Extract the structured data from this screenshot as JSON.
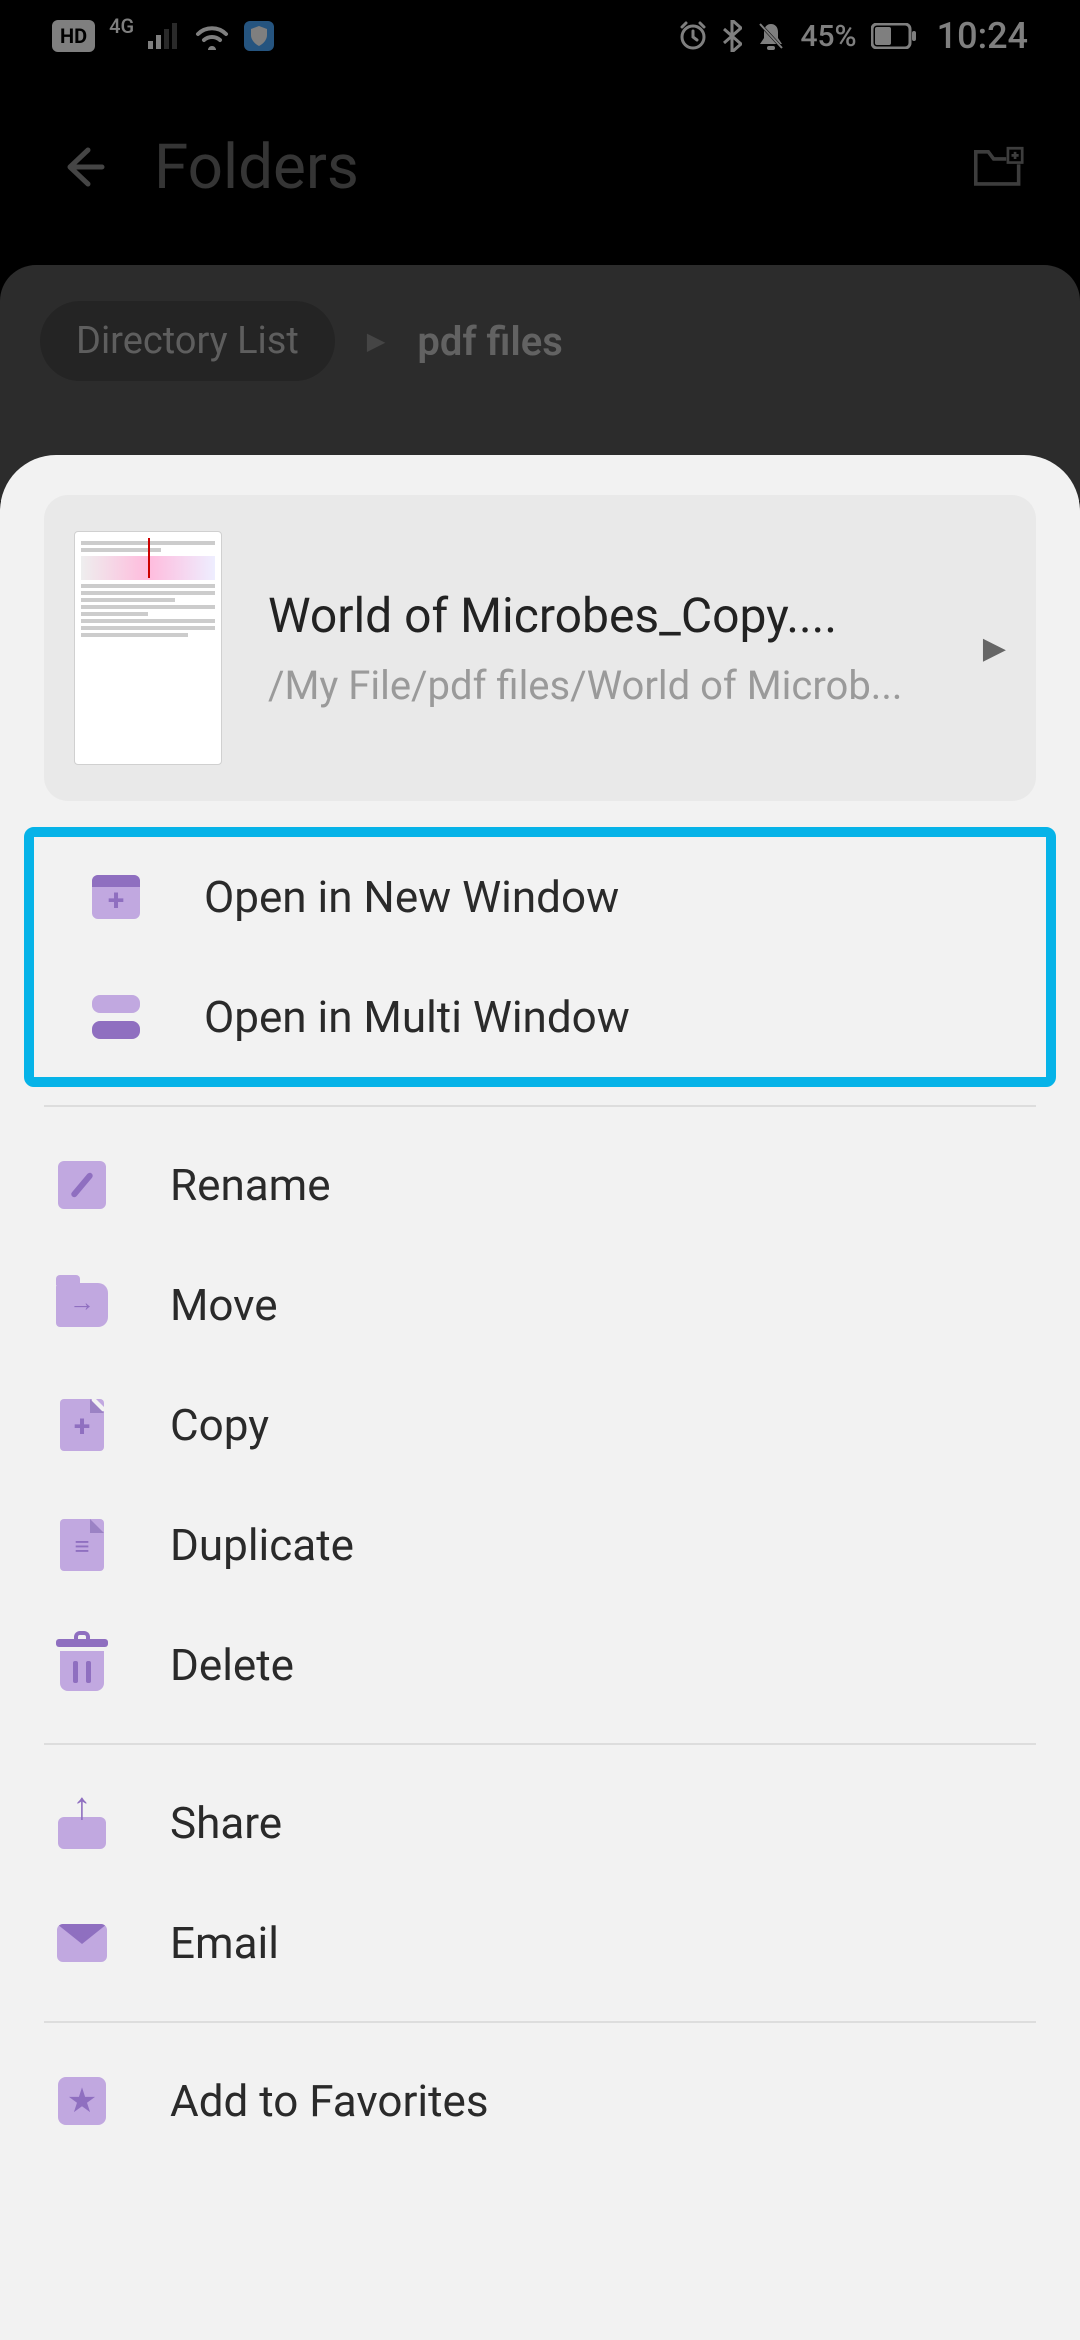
{
  "status": {
    "hd": "HD",
    "network": "4G",
    "battery_pct": "45%",
    "time": "10:24"
  },
  "header": {
    "title": "Folders"
  },
  "breadcrumb": {
    "root": "Directory List",
    "current": "pdf files"
  },
  "file": {
    "name": "World of Microbes_Copy....",
    "path": "/My File/pdf files/World of Microb..."
  },
  "menu": {
    "open_new_window": "Open in New Window",
    "open_multi_window": "Open in Multi Window",
    "rename": "Rename",
    "move": "Move",
    "copy": "Copy",
    "duplicate": "Duplicate",
    "delete": "Delete",
    "share": "Share",
    "email": "Email",
    "add_favorites": "Add to Favorites"
  }
}
